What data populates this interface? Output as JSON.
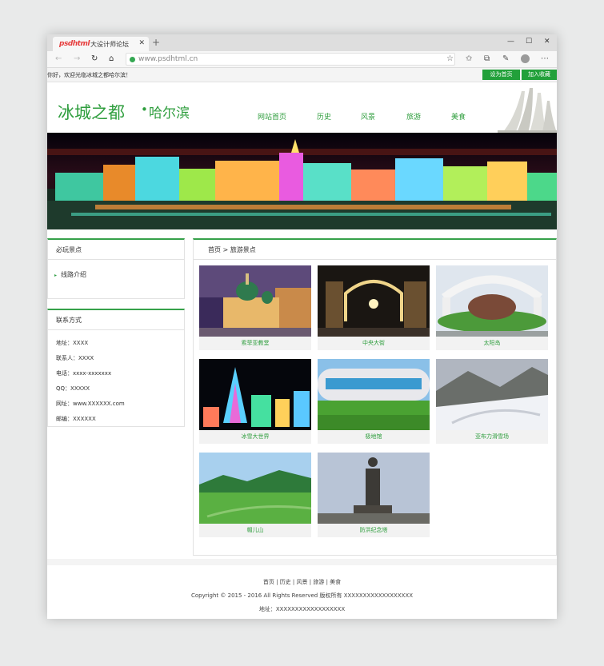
{
  "browser": {
    "tab_title": "大设计师论坛",
    "tab_logo": "psdhtml",
    "url": "www.psdhtml.cn"
  },
  "site": {
    "welcome": "你好，欢迎光临冰城之都哈尔滨！",
    "set_home": "设为首页",
    "add_favorite": "加入收藏",
    "logo_main": "冰城之都",
    "logo_dot": "•",
    "logo_sub": "哈尔滨",
    "nav": [
      "网站首页",
      "历史",
      "风景",
      "旅游",
      "美食"
    ]
  },
  "sidebar": {
    "must_play_title": "必玩景点",
    "route_item": "线路介绍",
    "contact_title": "联系方式",
    "contacts": [
      "地址：XXXX",
      "联系人：XXXX",
      "电话：xxxx-xxxxxxx",
      "QQ：XXXXX",
      "网址：www.XXXXXX.com",
      "邮编：XXXXXX"
    ]
  },
  "main": {
    "crumb_home": "首页",
    "crumb_sep": ">",
    "crumb_current": "旅游景点",
    "spots": [
      "索菲亚教堂",
      "中央大街",
      "太阳岛",
      "冰雪大世界",
      "极地馆",
      "亚布力滑雪场",
      "帽儿山",
      "防洪纪念塔"
    ]
  },
  "footer": {
    "links": [
      "首页",
      "历史",
      "风景",
      "旅游",
      "美食"
    ],
    "sep": "|",
    "copyright": "Copyright © 2015 - 2016 All Rights Reserved 版权所有 XXXXXXXXXXXXXXXXXX",
    "address": "地址：XXXXXXXXXXXXXXXXXX"
  },
  "colors": {
    "accent": "#2f9e3e",
    "button": "#22a03a"
  }
}
